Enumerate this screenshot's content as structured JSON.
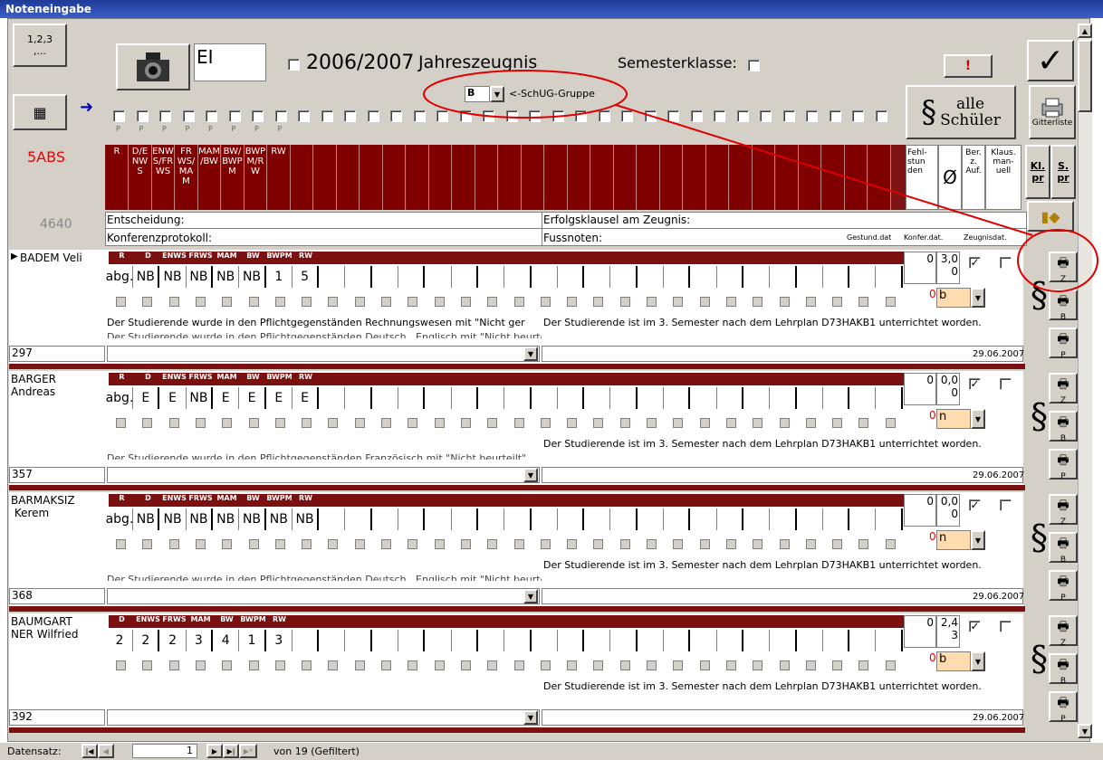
{
  "window": {
    "title": "Noteneingabe"
  },
  "header": {
    "order_button": "1,2,3\n,...",
    "class_code": "EI",
    "year": "2006/2007",
    "report_type": "Jahreszeugnis",
    "semester_label": "Semesterklasse:",
    "alert_button": "!",
    "group_value": "B",
    "group_label": "<-SchUG-Gruppe",
    "alle_schueler": "alle\nSchüler",
    "gitterliste": "Gitterliste",
    "class_name": "5ABS",
    "count": "4640",
    "subjects": [
      "R",
      "D/E\nNW\nS",
      "ENW\nS/FR\nWS",
      "FR\nWS/\nMA\nM",
      "MAM\n/BW",
      "BW/\nBWP\nM",
      "BWP\nM/R\nW",
      "RW"
    ],
    "subject_markers": [
      "P",
      "P",
      "P",
      "P",
      "P",
      "P",
      "P",
      "P"
    ],
    "col_fehlstunden": "Fehl-\nstun\nden",
    "col_avg": "Ø",
    "col_ber": "Ber.\nz.\nAuf.",
    "col_klaus": "Klaus.\nman-\nuell",
    "kl_pr": "Kl.\npr",
    "s_pr": "S.\npr",
    "entscheidung": "Entscheidung:",
    "konferenzprotokoll": "Konferenzprotokoll:",
    "erfolgsklausel": "Erfolgsklausel am Zeugnis:",
    "fussnoten": "Fussnoten:",
    "gestund": "Gestund.dat",
    "konfer": "Konfer.dat.",
    "zeugnis": "Zeugnisdat."
  },
  "students": [
    {
      "name": "BADEM Veli",
      "id": "297",
      "heads": [
        "R",
        "D",
        "ENWS",
        "FRWS",
        "MAM",
        "BW",
        "BWPM",
        "RW"
      ],
      "grades": [
        "abg.",
        "NB",
        "NB",
        "NB",
        "NB",
        "NB",
        "1",
        "5"
      ],
      "fehl": "0",
      "avg": "3,0\n0",
      "ber": "b",
      "text1": "Der Studierende wurde in den Pflichtgegenständen Rechnungswesen  mit \"Nicht ger",
      "text1b": "Der Studierende ist im 3. Semester nach dem Lehrplan D73HAKB1 unterrichtet worden.",
      "text2": "Der Studierende wurde in den Pflichtgegenständen Deutsch , Englisch mit \"Nicht beurteilt\"...",
      "date": "29.06.2007"
    },
    {
      "name": "BARGER\nAndreas",
      "id": "357",
      "heads": [
        "R",
        "D",
        "ENWS",
        "FRWS",
        "MAM",
        "BW",
        "BWPM",
        "RW"
      ],
      "grades": [
        "abg.",
        "E",
        "E",
        "NB",
        "E",
        "E",
        "E",
        "E"
      ],
      "fehl": "0",
      "avg": "0,0\n0",
      "ber": "n",
      "text1": "",
      "text1b": "Der Studierende ist im 3. Semester nach dem Lehrplan D73HAKB1 unterrichtet worden.",
      "text2": "Der Studierende wurde in den Pflichtgegenständen Französisch mit \"Nicht beurteilt\"...",
      "date": "29.06.2007"
    },
    {
      "name": "BARMAKSIZ\n Kerem",
      "id": "368",
      "heads": [
        "R",
        "D",
        "ENWS",
        "FRWS",
        "MAM",
        "BW",
        "BWPM",
        "RW"
      ],
      "grades": [
        "abg.",
        "NB",
        "NB",
        "NB",
        "NB",
        "NB",
        "NB",
        "NB"
      ],
      "fehl": "0",
      "avg": "0,0\n0",
      "ber": "n",
      "text1": "",
      "text1b": "Der Studierende ist im 3. Semester nach dem Lehrplan D73HAKB1 unterrichtet worden.",
      "text2": "Der Studierende wurde in den Pflichtgegenständen Deutsch , Englisch mit \"Nicht beurteilt\"...",
      "date": "29.06.2007"
    },
    {
      "name": "BAUMGART\nNER Wilfried",
      "id": "392",
      "heads": [
        "D",
        "ENWS",
        "FRWS",
        "MAM",
        "BW",
        "BWPM",
        "RW"
      ],
      "grades": [
        "2",
        "2",
        "2",
        "3",
        "4",
        "1",
        "3"
      ],
      "fehl": "0",
      "avg": "2,4\n3",
      "ber": "b",
      "text1": "",
      "text1b": "Der Studierende ist im 3. Semester nach dem Lehrplan D73HAKB1 unterrichtet worden.",
      "text2": "",
      "date": "29.06.2007"
    }
  ],
  "paragraph_symbol": "§",
  "print_labels": [
    "Z",
    "B",
    "P"
  ],
  "statusbar": {
    "label": "Datensatz:",
    "record": "1",
    "of_text": "von 19 (Gefiltert)"
  },
  "colors": {
    "dark_red": "#800000",
    "face": "#d4d0c8",
    "annotation_red": "#e00000"
  }
}
